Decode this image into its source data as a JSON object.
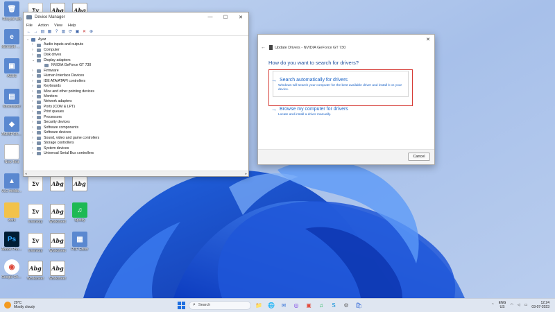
{
  "desktop": {
    "icons": [
      {
        "label": "Recycle Bin",
        "glyph": "🗑",
        "kind": "app"
      },
      {
        "label": "Microsoft Edge",
        "glyph": "e",
        "kind": "app"
      },
      {
        "label": "ASUS",
        "glyph": "▣",
        "kind": "app"
      },
      {
        "label": "Kinemaster",
        "glyph": "▤",
        "kind": "app"
      },
      {
        "label": "ASUSPCAssistant",
        "glyph": "◆",
        "kind": "app"
      },
      {
        "label": "New Text",
        "glyph": "",
        "kind": "doc"
      },
      {
        "label": "VLC media player",
        "glyph": "▲",
        "kind": "app"
      },
      {
        "label": "",
        "glyph": "Σv",
        "kind": "sigma"
      },
      {
        "label": "",
        "glyph": "Abg",
        "kind": "abg"
      },
      {
        "label": "",
        "glyph": "Abg",
        "kind": "abg"
      },
      {
        "label": "Σv Ims",
        "glyph": "Σv",
        "kind": "sigma"
      },
      {
        "label": "Abg",
        "glyph": "Abg",
        "kind": "abg"
      },
      {
        "label": "Abg",
        "glyph": "Abg",
        "kind": "abg"
      },
      {
        "label": "Abg",
        "glyph": "Abg",
        "kind": "abg"
      },
      {
        "label": "work",
        "glyph": "",
        "kind": "folder"
      },
      {
        "label": "Inventory",
        "glyph": "Σv",
        "kind": "sigma"
      },
      {
        "label": "Worksheet",
        "glyph": "Abg",
        "kind": "abg"
      },
      {
        "label": "Spotify",
        "glyph": "♫",
        "kind": "spotify"
      },
      {
        "label": "Adobe Photoshop",
        "glyph": "Ps",
        "kind": "ps"
      },
      {
        "label": "Inventory",
        "glyph": "Σv",
        "kind": "sigma"
      },
      {
        "label": "Worksheet",
        "glyph": "Abg",
        "kind": "abg"
      },
      {
        "label": "PDF Editor",
        "glyph": "▦",
        "kind": "app"
      },
      {
        "label": "Google Chrome",
        "glyph": "◉",
        "kind": "chrome"
      },
      {
        "label": "Worksheet",
        "glyph": "Abg",
        "kind": "abg"
      },
      {
        "label": "Worksheet",
        "glyph": "Abg",
        "kind": "abg"
      }
    ]
  },
  "device_manager": {
    "title": "Device Manager",
    "window_controls": [
      "—",
      "☐",
      "✕"
    ],
    "menu": [
      "File",
      "Action",
      "View",
      "Help"
    ],
    "toolbar": [
      "←",
      "→",
      "▤",
      "▦",
      "?",
      "▥",
      "⟳",
      "▣",
      "✕",
      "⊕"
    ],
    "root": "Ayaz",
    "tree": [
      {
        "label": "Audio inputs and outputs",
        "expanded": false
      },
      {
        "label": "Computer",
        "expanded": false
      },
      {
        "label": "Disk drives",
        "expanded": false
      },
      {
        "label": "Display adapters",
        "expanded": true
      },
      {
        "label": "NVIDIA GeForce GT 730",
        "child": true
      },
      {
        "label": "Firmware",
        "expanded": false
      },
      {
        "label": "Human Interface Devices",
        "expanded": false
      },
      {
        "label": "IDE ATA/ATAPI controllers",
        "expanded": false
      },
      {
        "label": "Keyboards",
        "expanded": false
      },
      {
        "label": "Mice and other pointing devices",
        "expanded": false
      },
      {
        "label": "Monitors",
        "expanded": false
      },
      {
        "label": "Network adapters",
        "expanded": false
      },
      {
        "label": "Ports (COM & LPT)",
        "expanded": false
      },
      {
        "label": "Print queues",
        "expanded": false
      },
      {
        "label": "Processors",
        "expanded": false
      },
      {
        "label": "Security devices",
        "expanded": false
      },
      {
        "label": "Software components",
        "expanded": false
      },
      {
        "label": "Software devices",
        "expanded": false
      },
      {
        "label": "Sound, video and game controllers",
        "expanded": false
      },
      {
        "label": "Storage controllers",
        "expanded": false
      },
      {
        "label": "System devices",
        "expanded": false
      },
      {
        "label": "Universal Serial Bus controllers",
        "expanded": false
      }
    ]
  },
  "update_drivers": {
    "title": "Update Drivers - NVIDIA GeForce GT 730",
    "question": "How do you want to search for drivers?",
    "option1_title": "Search automatically for drivers",
    "option1_desc": "Windows will search your computer for the best available driver and install it on your device.",
    "option2_title": "Browse my computer for drivers",
    "option2_desc": "Locate and install a driver manually.",
    "cancel_label": "Cancel",
    "highlight_color": "#d63b35",
    "link_color": "#1b63c6"
  },
  "taskbar": {
    "weather_temp": "29°C",
    "weather_desc": "Mostly cloudy",
    "search_placeholder": "Search",
    "apps": [
      "📁",
      "🌐",
      "✉",
      "◎",
      "▣",
      "♫",
      "S",
      "⚙",
      "🛍"
    ],
    "lang_line1": "ENG",
    "lang_line2": "US",
    "time": "12:24",
    "date": "03-07-2023"
  }
}
